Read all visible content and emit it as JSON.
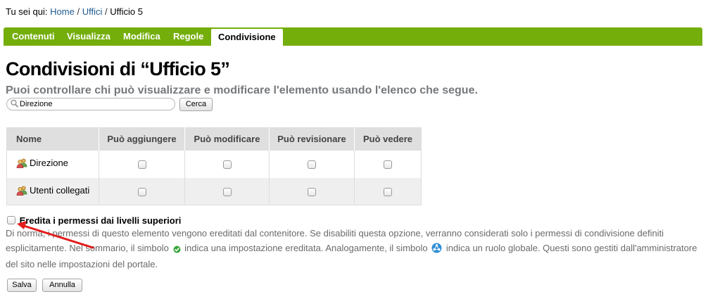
{
  "breadcrumb": {
    "prefix": "Tu sei qui:",
    "items": [
      "Home",
      "Uffici",
      "Ufficio 5"
    ],
    "separator": "/"
  },
  "tabs": [
    {
      "label": "Contenuti",
      "active": false
    },
    {
      "label": "Visualizza",
      "active": false
    },
    {
      "label": "Modifica",
      "active": false
    },
    {
      "label": "Regole",
      "active": false
    },
    {
      "label": "Condivisione",
      "active": true
    }
  ],
  "page": {
    "title": "Condivisioni di “Ufficio 5”",
    "subtitle": "Puoi controllare chi può visualizzare e modificare l'elemento usando l'elenco che segue."
  },
  "search": {
    "value": "Direzione",
    "button_label": "Cerca"
  },
  "table": {
    "headers": [
      "Nome",
      "Può aggiungere",
      "Può modificare",
      "Può revisionare",
      "Può vedere"
    ],
    "rows": [
      {
        "name": "Direzione",
        "icon": "user-group-icon",
        "permissions": [
          false,
          false,
          false,
          false
        ]
      },
      {
        "name": "Utenti collegati",
        "icon": "user-group-icon",
        "permissions": [
          false,
          false,
          false,
          false
        ]
      }
    ]
  },
  "inherit": {
    "label": "Eredita i permessi dai livelli superiori",
    "checked": false
  },
  "help": {
    "part1": "Di norma, i permessi di questo elemento vengono ereditati dal contenitore. Se disabiliti questa opzione, verranno considerati solo i permessi di condivisione definiti esplicitamente. Nel sommario, il simbolo",
    "part2": "indica una impostazione ereditata. Analogamente, il simbolo",
    "part3": "indica un ruolo globale. Questi sono gestiti dall'amministratore del sito nelle impostazioni del portale."
  },
  "form": {
    "save_label": "Salva",
    "cancel_label": "Annulla"
  },
  "colors": {
    "tab_bar": "#74ae0b",
    "link": "#205c90",
    "arrow": "#e31c1c",
    "inherited_icon": "#3aa53a",
    "global_role_icon": "#2f8fd8"
  }
}
